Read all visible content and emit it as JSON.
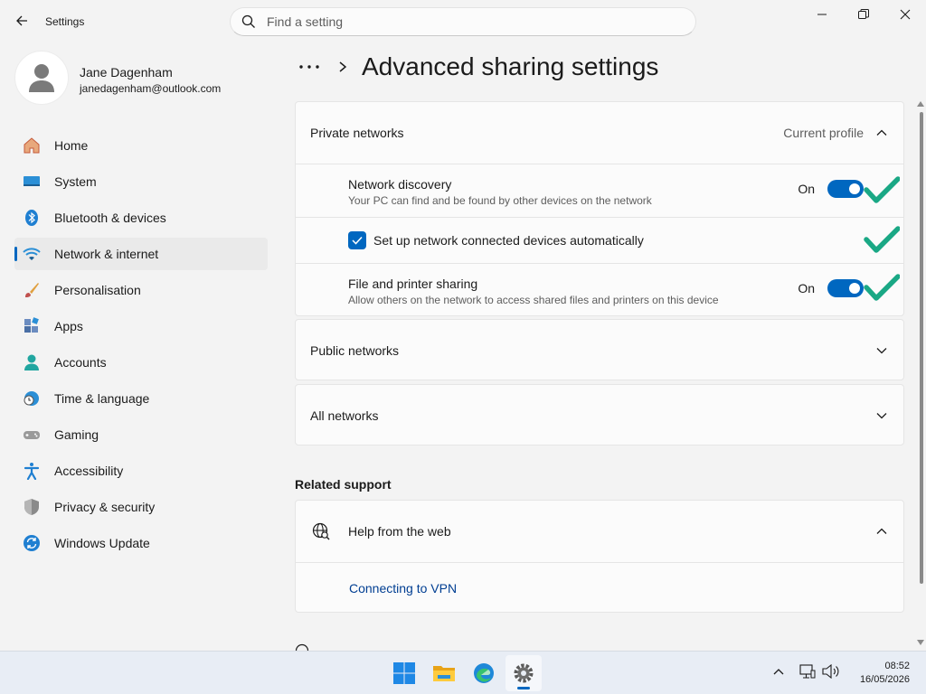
{
  "window": {
    "title": "Settings",
    "back_icon": "back-arrow-icon",
    "search_placeholder": "Find a setting",
    "search_value": "",
    "controls": [
      "minimize-icon",
      "maximize-icon",
      "close-icon"
    ]
  },
  "profile": {
    "name": "Jane Dagenham",
    "email": "janedagenham@outlook.com"
  },
  "sidebar": {
    "items": [
      {
        "label": "Home",
        "icon": "home-icon",
        "active": false
      },
      {
        "label": "System",
        "icon": "system-icon",
        "active": false
      },
      {
        "label": "Bluetooth & devices",
        "icon": "bluetooth-icon",
        "active": false
      },
      {
        "label": "Network & internet",
        "icon": "wifi-icon",
        "active": true
      },
      {
        "label": "Personalisation",
        "icon": "brush-icon",
        "active": false
      },
      {
        "label": "Apps",
        "icon": "apps-icon",
        "active": false
      },
      {
        "label": "Accounts",
        "icon": "accounts-icon",
        "active": false
      },
      {
        "label": "Time & language",
        "icon": "time-language-icon",
        "active": false
      },
      {
        "label": "Gaming",
        "icon": "gaming-icon",
        "active": false
      },
      {
        "label": "Accessibility",
        "icon": "accessibility-icon",
        "active": false
      },
      {
        "label": "Privacy & security",
        "icon": "shield-icon",
        "active": false
      },
      {
        "label": "Windows Update",
        "icon": "update-icon",
        "active": false
      }
    ]
  },
  "main": {
    "breadcrumb_more": "more-icon",
    "page_title": "Advanced sharing settings",
    "private": {
      "label": "Private networks",
      "meta": "Current profile",
      "expanded": true,
      "network_discovery": {
        "title": "Network discovery",
        "desc": "Your PC can find and be found by other devices on the network",
        "state": "On",
        "on": true
      },
      "auto_setup": {
        "label": "Set up network connected devices automatically",
        "checked": true
      },
      "file_sharing": {
        "title": "File and printer sharing",
        "desc": "Allow others on the network to access shared files and printers on this device",
        "state": "On",
        "on": true
      }
    },
    "public": {
      "label": "Public networks",
      "expanded": false
    },
    "all": {
      "label": "All networks",
      "expanded": false
    },
    "related_support": {
      "title": "Related support",
      "help_label": "Help from the web",
      "link": "Connecting to VPN"
    }
  },
  "annotations": {
    "check_color": "#1aa885"
  },
  "colors": {
    "accent": "#0067c0",
    "link": "#003e92"
  },
  "taskbar": {
    "apps": [
      "windows-start-icon",
      "file-explorer-icon",
      "edge-icon",
      "settings-icon"
    ],
    "time": "08:52",
    "date": "16/05/2026"
  }
}
